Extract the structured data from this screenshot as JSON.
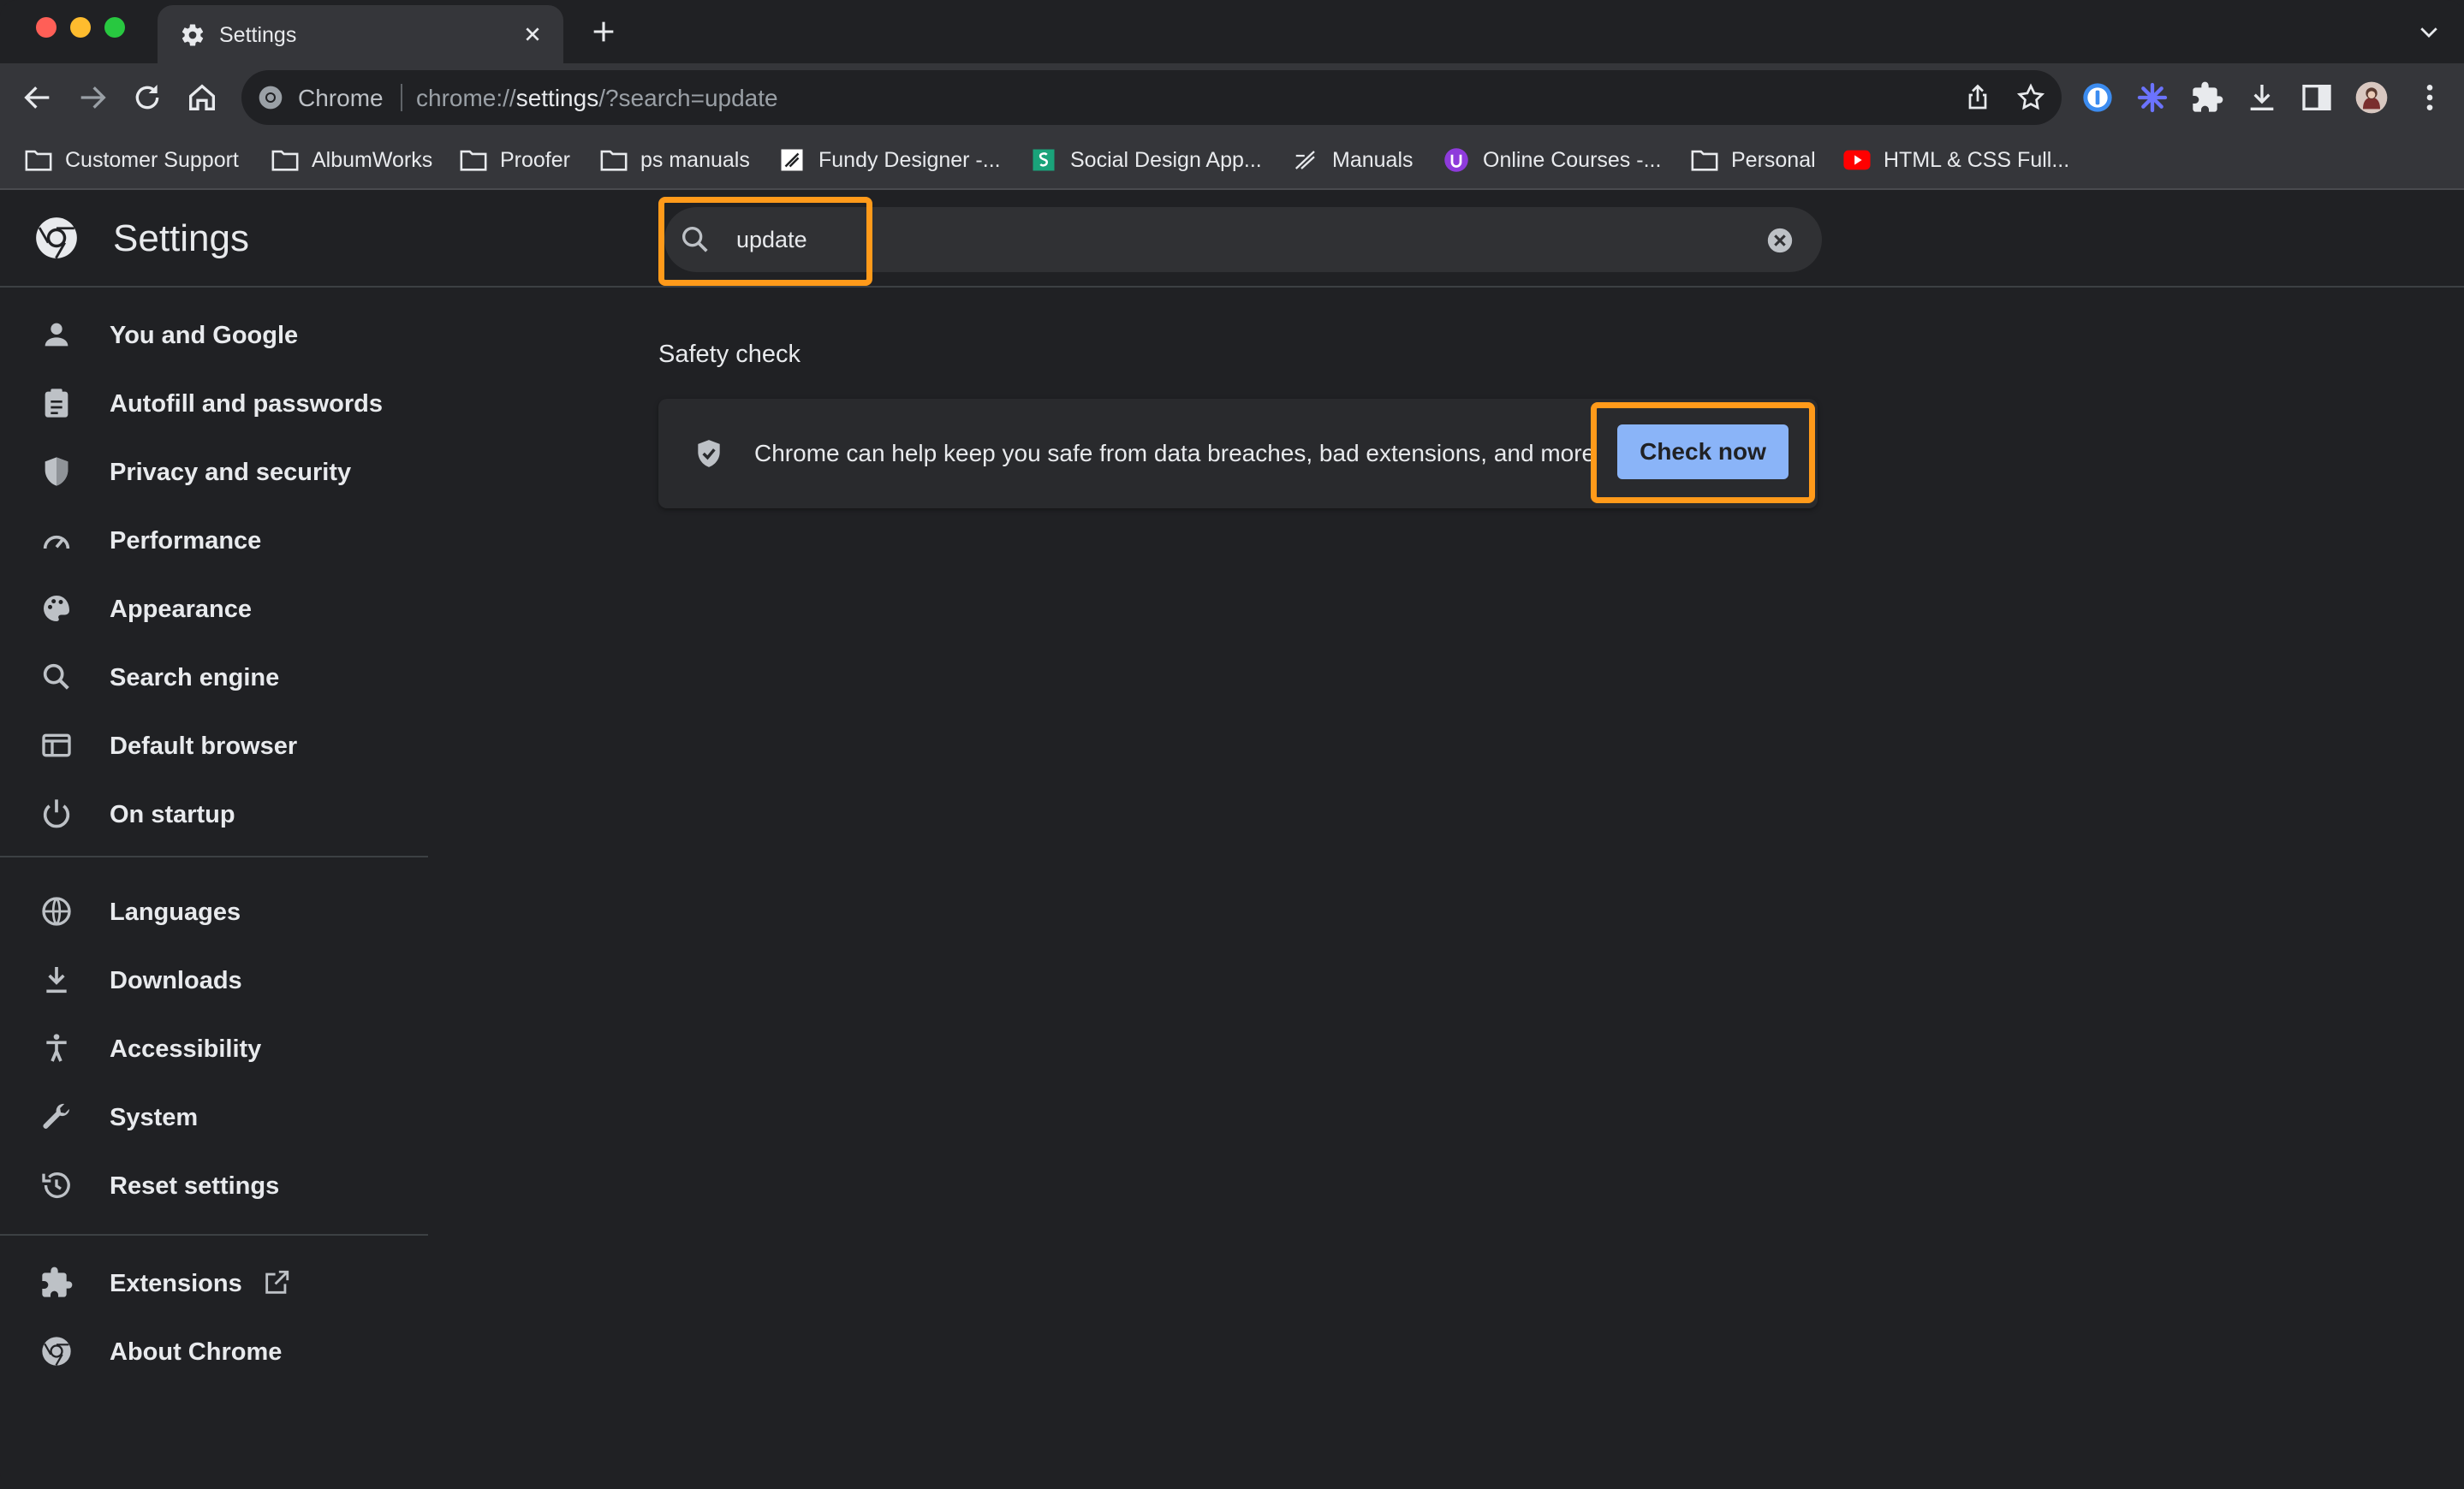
{
  "window": {
    "tab_title": "Settings"
  },
  "omnibox": {
    "site_label": "Chrome",
    "url_prefix": "chrome://",
    "url_host": "settings",
    "url_path": "/?search=update"
  },
  "bookmarks": [
    {
      "label": "Customer Support",
      "icon": "folder-icon"
    },
    {
      "label": "AlbumWorks",
      "icon": "folder-icon"
    },
    {
      "label": "Proofer",
      "icon": "folder-icon"
    },
    {
      "label": "ps manuals",
      "icon": "folder-icon"
    },
    {
      "label": "Fundy Designer -...",
      "icon": "fundy-icon"
    },
    {
      "label": "Social Design App...",
      "icon": "social-design-icon"
    },
    {
      "label": "Manuals",
      "icon": "manuals-icon"
    },
    {
      "label": "Online Courses -...",
      "icon": "courses-icon"
    },
    {
      "label": "Personal",
      "icon": "folder-icon"
    },
    {
      "label": "HTML & CSS Full...",
      "icon": "youtube-icon"
    }
  ],
  "settings": {
    "title": "Settings",
    "search_value": "update",
    "nav": [
      {
        "label": "You and Google",
        "icon": "person-icon"
      },
      {
        "label": "Autofill and passwords",
        "icon": "clipboard-icon"
      },
      {
        "label": "Privacy and security",
        "icon": "shield-icon"
      },
      {
        "label": "Performance",
        "icon": "speedometer-icon"
      },
      {
        "label": "Appearance",
        "icon": "palette-icon"
      },
      {
        "label": "Search engine",
        "icon": "search-icon"
      },
      {
        "label": "Default browser",
        "icon": "browser-icon"
      },
      {
        "label": "On startup",
        "icon": "power-icon"
      },
      {
        "label": "Languages",
        "icon": "globe-icon"
      },
      {
        "label": "Downloads",
        "icon": "download-icon"
      },
      {
        "label": "Accessibility",
        "icon": "accessibility-icon"
      },
      {
        "label": "System",
        "icon": "wrench-icon"
      },
      {
        "label": "Reset settings",
        "icon": "history-icon"
      },
      {
        "label": "Extensions",
        "icon": "puzzle-icon"
      },
      {
        "label": "About Chrome",
        "icon": "chrome-icon"
      }
    ]
  },
  "safety_check": {
    "section_title": "Safety check",
    "description": "Chrome can help keep you safe from data breaches, bad extensions, and more",
    "button_label": "Check now"
  },
  "colors": {
    "highlight": "#ff9a1a",
    "button": "#8ab4f8",
    "background": "#202124"
  }
}
